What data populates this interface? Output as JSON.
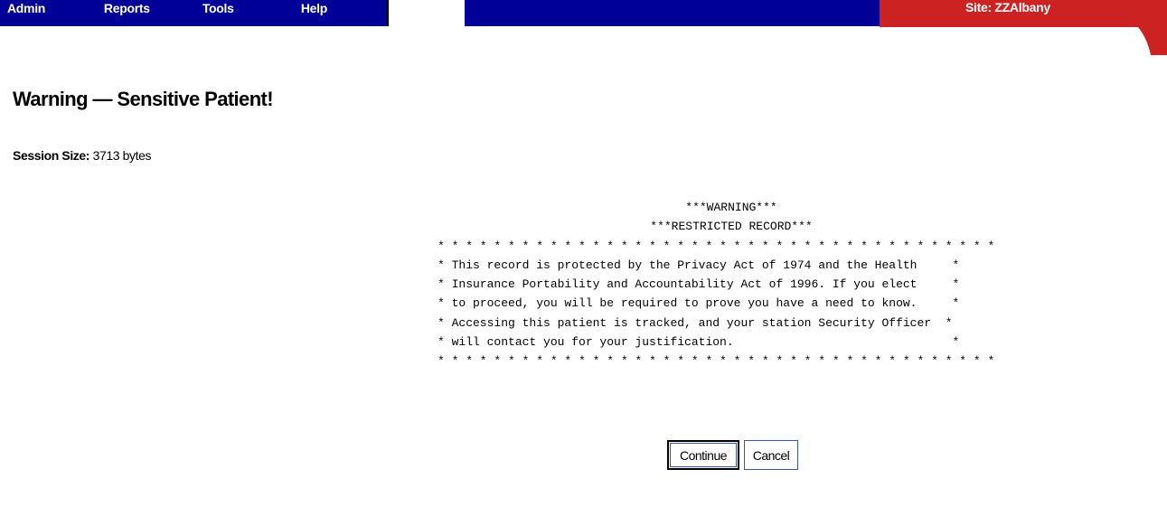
{
  "menu": {
    "items": [
      "Admin",
      "Reports",
      "Tools",
      "Help"
    ]
  },
  "site": {
    "label": "Site: ZZAlbany"
  },
  "page": {
    "title": "Warning — Sensitive Patient!",
    "session_label": "Session Size:",
    "session_value": "3713 bytes"
  },
  "warning": {
    "line1": "***WARNING***",
    "line2": "***RESTRICTED RECORD***",
    "border": "* * * * * * * * * * * * * * * * * * * * * * * * * * * * * * * * * * * * * * * *",
    "body": [
      "* This record is protected by the Privacy Act of 1974 and the Health     *",
      "* Insurance Portability and Accountability Act of 1996. If you elect     *",
      "* to proceed, you will be required to prove you have a need to know.     *",
      "* Accessing this patient is tracked, and your station Security Officer  *",
      "* will contact you for your justification.                               *"
    ]
  },
  "buttons": {
    "continue": "Continue",
    "cancel": "Cancel"
  },
  "colors": {
    "nav_blue": "#000099",
    "site_red": "#cc2222"
  }
}
